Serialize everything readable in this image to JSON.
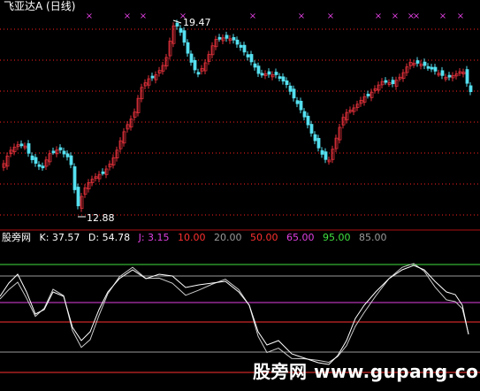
{
  "title": "飞亚达A (日线)",
  "price_high_label": "19.47",
  "price_low_label": "12.88",
  "indicator": {
    "name": "股旁网",
    "k": "K: 37.57",
    "d": "D: 54.78",
    "j": "J: 3.15",
    "levels": [
      "10.00",
      "20.00",
      "50.00",
      "65.00",
      "95.00",
      "85.00"
    ]
  },
  "watermark": "股旁网 www.gupang.com",
  "colors": {
    "up": "#e0303a",
    "down": "#55e0f0",
    "grid": "#ff2020",
    "k_line": "#ffffff",
    "marker": "#e040e0",
    "level_10": "#ff3030",
    "level_20": "#9a9a9a",
    "level_50": "#ff3030",
    "level_65": "#e040e0",
    "level_95": "#40e040",
    "level_85": "#9a9a9a"
  }
}
